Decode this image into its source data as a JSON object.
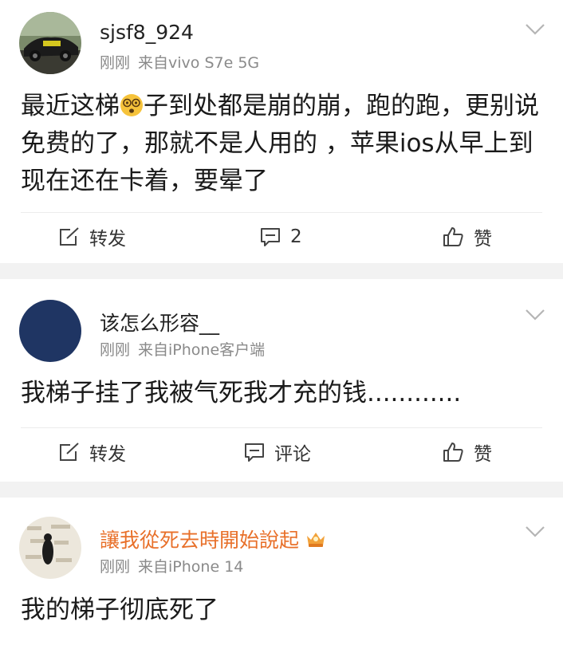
{
  "posts": [
    {
      "username": "sjsf8_924",
      "time": "刚刚",
      "source": "来自vivo S7e 5G",
      "text_before_emoji": "最近这梯",
      "emoji": "dizzy-face",
      "text_after_emoji": "子到处都是崩的崩，跑的跑，更别说免费的了，那就不是人用的 ，苹果ios从早上到现在还在卡着，要晕了",
      "actions": {
        "repost": "转发",
        "comment": "2",
        "like": "赞"
      }
    },
    {
      "username": "该怎么形容__",
      "time": "刚刚",
      "source": "来自iPhone客户端",
      "text": "我梯子挂了我被气死我才充的钱............",
      "actions": {
        "repost": "转发",
        "comment": "评论",
        "like": "赞"
      }
    },
    {
      "username": "讓我從死去時開始說起",
      "time": "刚刚",
      "source": "来自iPhone 14",
      "text": "我的梯子彻底死了"
    }
  ],
  "colors": {
    "vip_name": "#e8702a",
    "meta": "#8a8a8a",
    "separator": "#f2f2f2",
    "avatar_navy": "#1f3563"
  }
}
